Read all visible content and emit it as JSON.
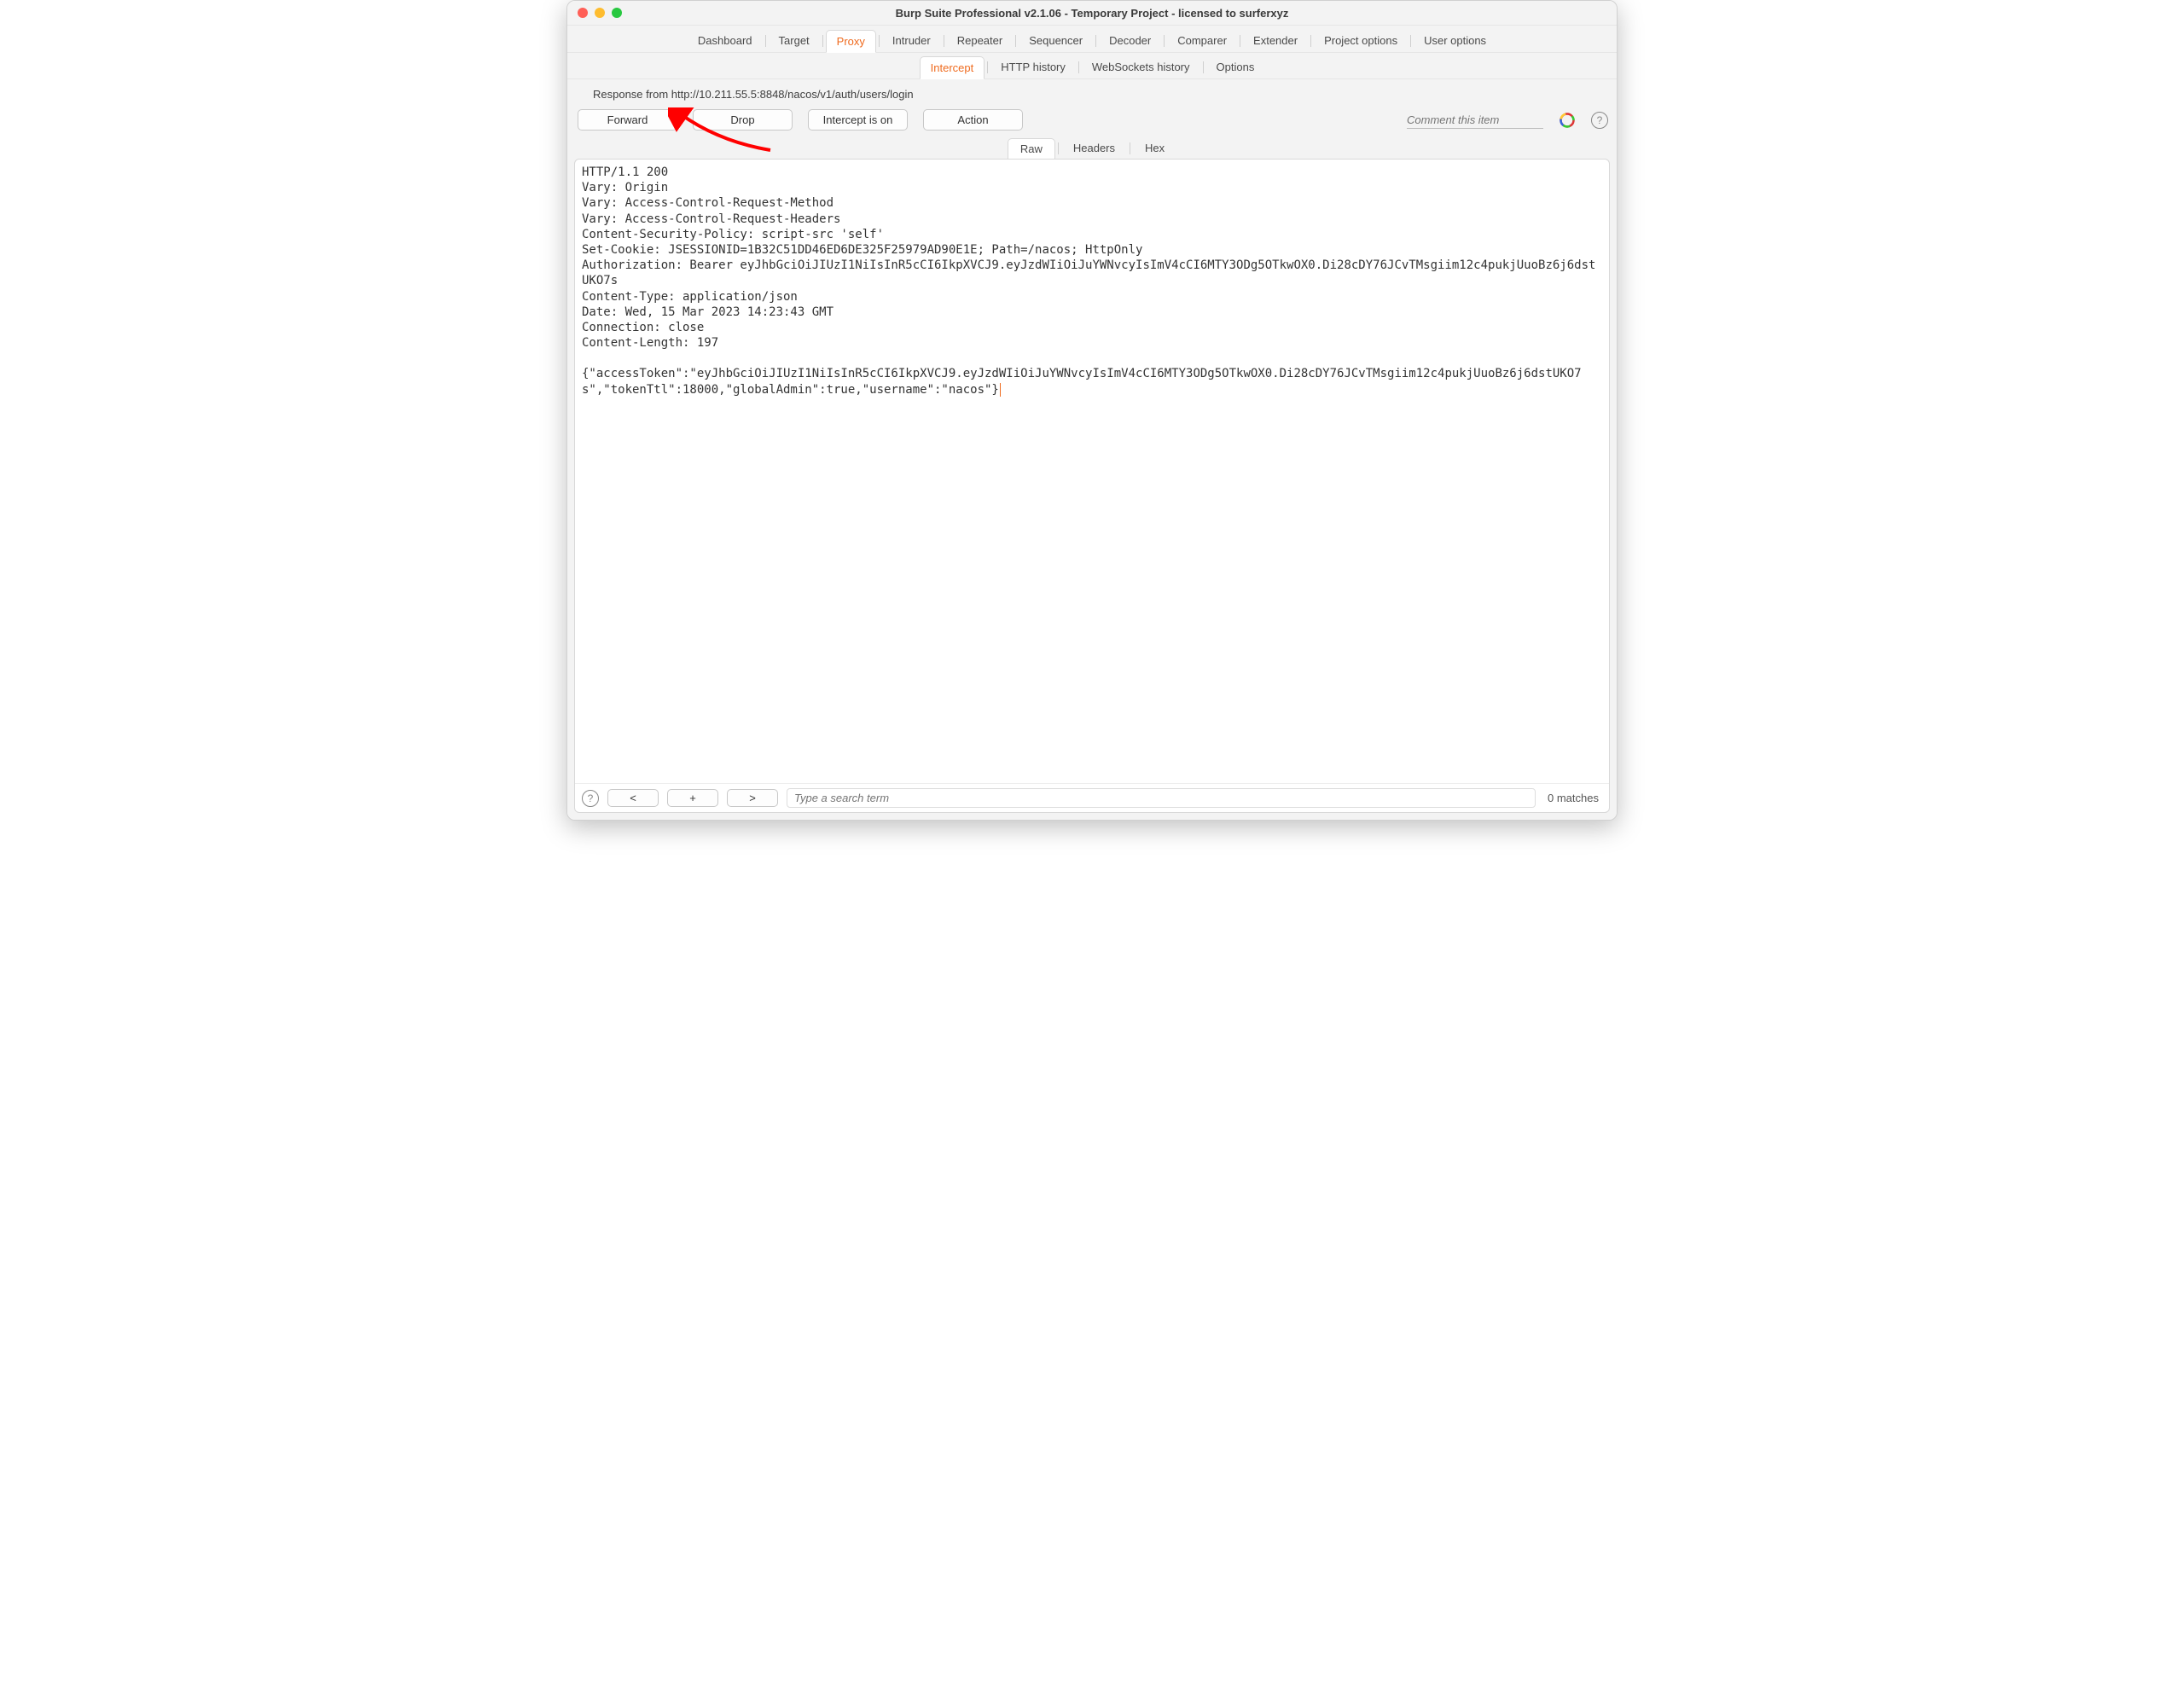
{
  "window_title": "Burp Suite Professional v2.1.06 - Temporary Project - licensed to surferxyz",
  "main_tabs": [
    "Dashboard",
    "Target",
    "Proxy",
    "Intruder",
    "Repeater",
    "Sequencer",
    "Decoder",
    "Comparer",
    "Extender",
    "Project options",
    "User options"
  ],
  "main_tab_active": "Proxy",
  "sub_tabs": [
    "Intercept",
    "HTTP history",
    "WebSockets history",
    "Options"
  ],
  "sub_tab_active": "Intercept",
  "info_line": "Response from http://10.211.55.5:8848/nacos/v1/auth/users/login",
  "buttons": {
    "forward": "Forward",
    "drop": "Drop",
    "intercept": "Intercept is on",
    "action": "Action"
  },
  "comment_placeholder": "Comment this item",
  "view_tabs": [
    "Raw",
    "Headers",
    "Hex"
  ],
  "view_tab_active": "Raw",
  "response_text": "HTTP/1.1 200\nVary: Origin\nVary: Access-Control-Request-Method\nVary: Access-Control-Request-Headers\nContent-Security-Policy: script-src 'self'\nSet-Cookie: JSESSIONID=1B32C51DD46ED6DE325F25979AD90E1E; Path=/nacos; HttpOnly\nAuthorization: Bearer eyJhbGciOiJIUzI1NiIsInR5cCI6IkpXVCJ9.eyJzdWIiOiJuYWNvcyIsImV4cCI6MTY3ODg5OTkwOX0.Di28cDY76JCvTMsgiim12c4pukjUuoBz6j6dstUKO7s\nContent-Type: application/json\nDate: Wed, 15 Mar 2023 14:23:43 GMT\nConnection: close\nContent-Length: 197\n\n{\"accessToken\":\"eyJhbGciOiJIUzI1NiIsInR5cCI6IkpXVCJ9.eyJzdWIiOiJuYWNvcyIsImV4cCI6MTY3ODg5OTkwOX0.Di28cDY76JCvTMsgiim12c4pukjUuoBz6j6dstUKO7s\",\"tokenTtl\":18000,\"globalAdmin\":true,\"username\":\"nacos\"}",
  "footer": {
    "prev": "<",
    "add": "+",
    "next": ">",
    "search_placeholder": "Type a search term",
    "matches": "0 matches"
  }
}
